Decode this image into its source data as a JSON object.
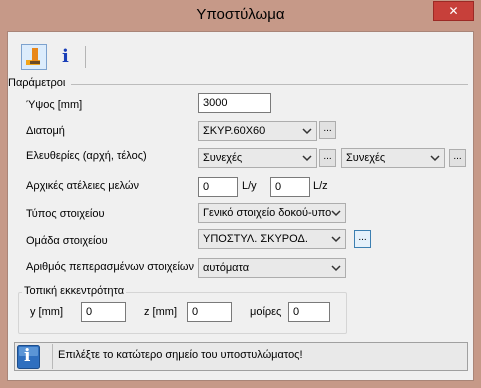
{
  "window": {
    "title": "Υποστύλωμα",
    "close_label": "✕"
  },
  "toolbar": {
    "icons": [
      "column-tool-icon",
      "info-icon"
    ],
    "info_glyph": "i"
  },
  "params": {
    "group_title": "Παράμετροι",
    "height_label": "Ύψος [mm]",
    "height_value": "3000",
    "section_label": "Διατομή",
    "section_value": "ΣΚΥΡ.60Χ60",
    "freedom_label": "Ελευθερίες (αρχή, τέλος)",
    "freedom_start": "Συνεχές",
    "freedom_end": "Συνεχές",
    "imperfections_label": "Αρχικές ατέλειες μελών",
    "imperf_y_value": "0",
    "imperf_y_unit": "L/y",
    "imperf_z_value": "0",
    "imperf_z_unit": "L/z",
    "element_type_label": "Τύπος στοιχείου",
    "element_type_value": "Γενικό στοιχείο δοκού-υπο",
    "element_group_label": "Ομάδα στοιχείου",
    "element_group_value": "ΥΠΟΣΤΥΛ. ΣΚΥΡΟΔ.",
    "finite_label": "Αριθμός πεπερασμένων στοιχείων",
    "finite_value": "αυτόματα",
    "dots_label": "..."
  },
  "eccentricity": {
    "title": "Τοπική εκκεντρότητα",
    "y_label": "y [mm]",
    "y_value": "0",
    "z_label": "z [mm]",
    "z_value": "0",
    "deg_label": "μοίρες",
    "deg_value": "0"
  },
  "status": {
    "text": "Επιλέξτε το κατώτερο σημείο του υποστυλώματος!",
    "icon": "info-icon",
    "glyph": "i"
  }
}
